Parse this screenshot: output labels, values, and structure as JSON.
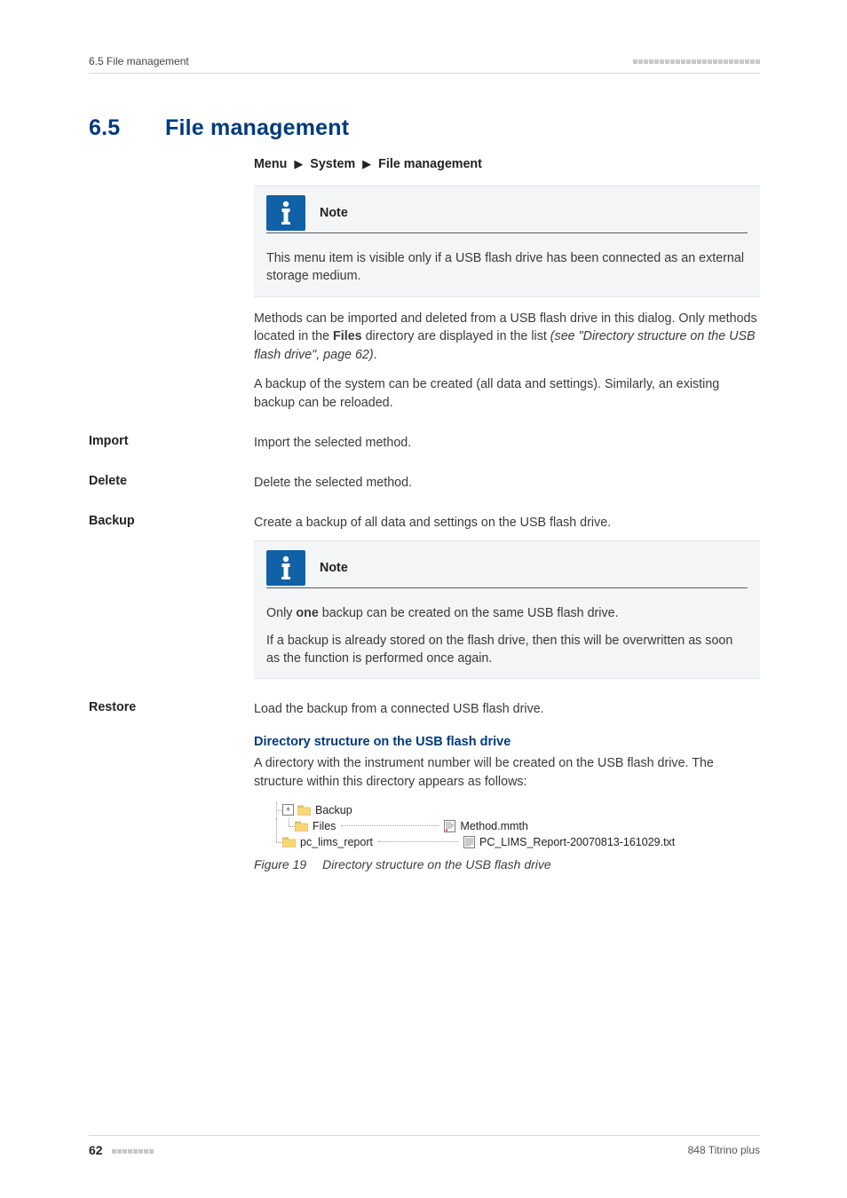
{
  "header": {
    "running_head": "6.5 File management"
  },
  "section": {
    "number": "6.5",
    "title": "File management"
  },
  "breadcrumb": {
    "p1": "Menu",
    "p2": "System",
    "p3": "File management"
  },
  "note1": {
    "label": "Note",
    "body": "This menu item is visible only if a USB flash drive has been connected as an external storage medium."
  },
  "intro": {
    "p1a": "Methods can be imported and deleted from a USB flash drive in this dialog. Only methods located in the ",
    "p1b": "Files",
    "p1c": " directory are displayed in the list ",
    "p1d": "(see \"Directory structure on the USB flash drive\", page 62)",
    "p1e": ".",
    "p2": "A backup of the system can be created (all data and settings). Similarly, an existing backup can be reloaded."
  },
  "terms": {
    "import": {
      "label": "Import",
      "desc": "Import the selected method."
    },
    "delete": {
      "label": "Delete",
      "desc": "Delete the selected method."
    },
    "backup": {
      "label": "Backup",
      "desc": "Create a backup of all data and settings on the USB flash drive."
    },
    "restore": {
      "label": "Restore",
      "desc": "Load the backup from a connected USB flash drive."
    }
  },
  "note2": {
    "label": "Note",
    "line1a": "Only ",
    "line1b": "one",
    "line1c": " backup can be created on the same USB flash drive.",
    "line2": "If a backup is already stored on the flash drive, then this will be overwritten as soon as the function is performed once again."
  },
  "dirsection": {
    "heading": "Directory structure on the USB flash drive",
    "para": "A directory with the instrument number will be created on the USB flash drive. The structure within this directory appears as follows:"
  },
  "tree": {
    "backup": "Backup",
    "files": "Files",
    "files_file": "Method.mmth",
    "pclims": "pc_lims_report",
    "pclims_file": "PC_LIMS_Report-20070813-161029.txt"
  },
  "figure": {
    "num": "Figure 19",
    "caption": "Directory structure on the USB flash drive"
  },
  "footer": {
    "page": "62",
    "product": "848 Titrino plus"
  }
}
